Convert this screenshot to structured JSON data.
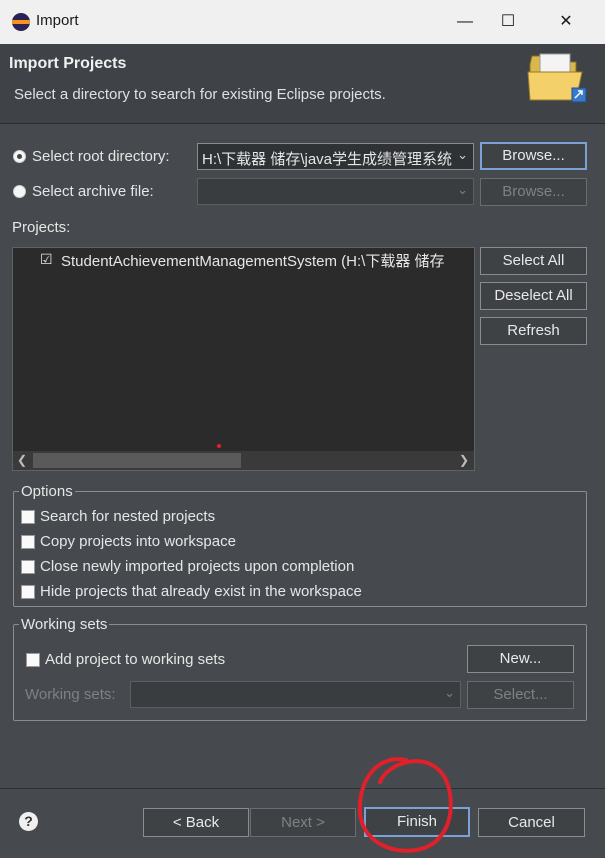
{
  "window": {
    "title": "Import",
    "minimize_glyph": "—",
    "maximize_glyph": "☐",
    "close_glyph": "✕"
  },
  "header": {
    "title": "Import Projects",
    "description": "Select a directory to search for existing Eclipse projects.",
    "icon": "folder-icon"
  },
  "source": {
    "root_dir_label": "Select root directory:",
    "root_dir_value": "H:\\下载器 储存\\java学生成绩管理系统",
    "archive_label": "Select archive file:",
    "archive_value": "",
    "browse_label": "Browse...",
    "selected": "root"
  },
  "projects": {
    "label": "Projects:",
    "items": [
      {
        "name": "StudentAchievementManagementSystem (H:\\下载器 储存",
        "checked": true
      }
    ],
    "select_all": "Select All",
    "deselect_all": "Deselect All",
    "refresh": "Refresh"
  },
  "options": {
    "legend": "Options",
    "items": [
      {
        "label": "Search for nested projects",
        "checked": false
      },
      {
        "label": "Copy projects into workspace",
        "checked": false
      },
      {
        "label": "Close newly imported projects upon completion",
        "checked": false
      },
      {
        "label": "Hide projects that already exist in the workspace",
        "checked": false
      }
    ]
  },
  "working_sets": {
    "legend": "Working sets",
    "add_label": "Add project to working sets",
    "add_checked": false,
    "sets_label": "Working sets:",
    "new_label": "New...",
    "select_label": "Select..."
  },
  "footer": {
    "help_glyph": "?",
    "back_label": "< Back",
    "next_label": "Next >",
    "finish_label": "Finish",
    "cancel_label": "Cancel"
  },
  "colors": {
    "annotation_circle": "#e0202a",
    "focus_border": "#7aa2d6"
  }
}
